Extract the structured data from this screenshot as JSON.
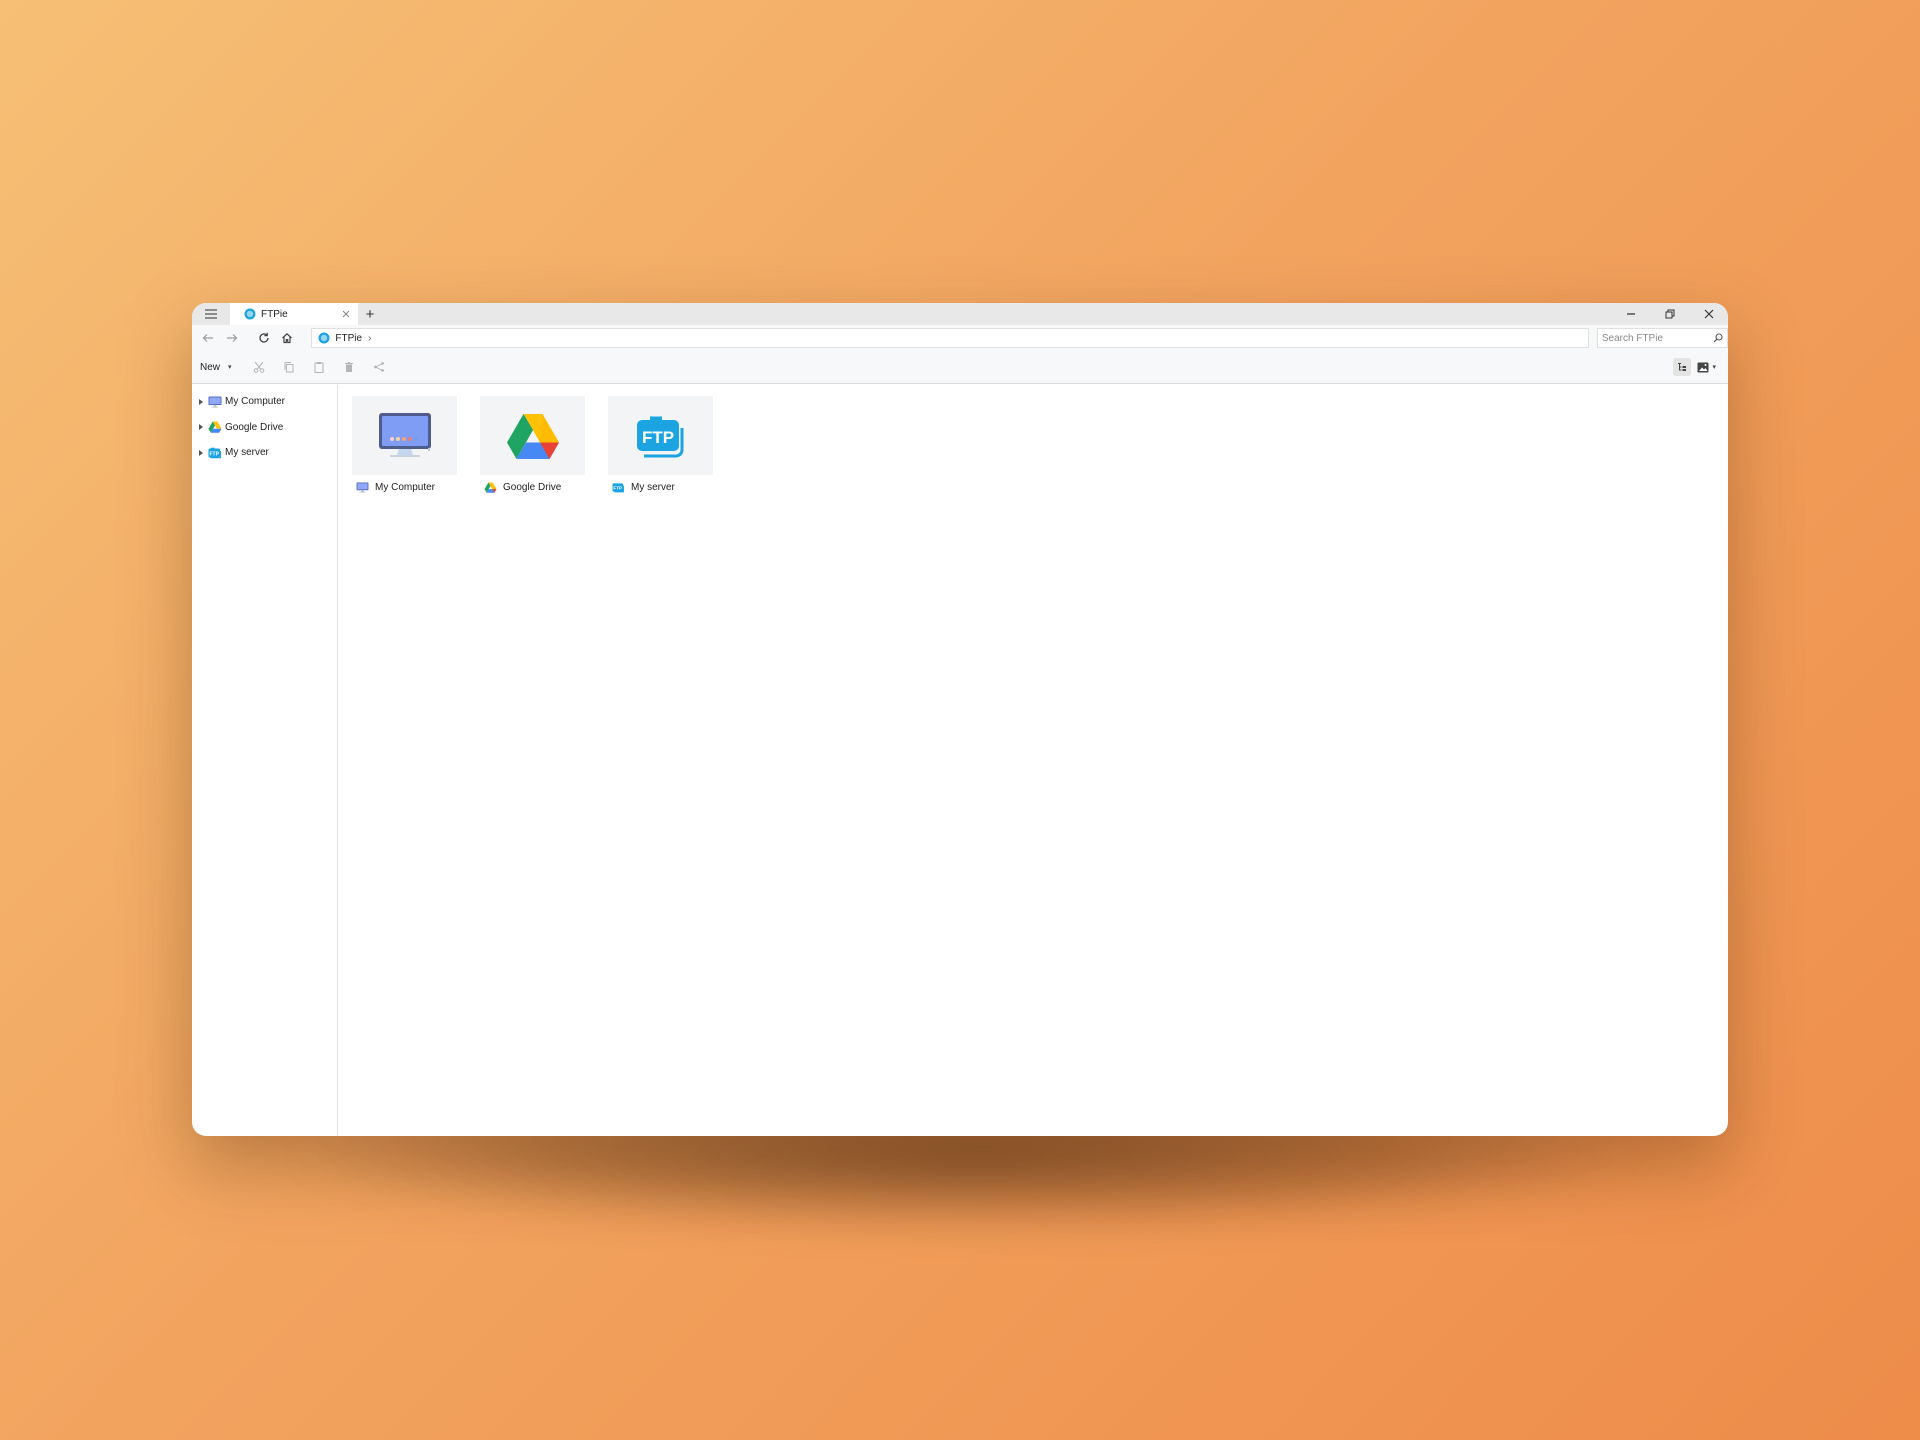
{
  "app": {
    "tab_title": "FTPie",
    "new_tab_symbol": "+"
  },
  "nav": {
    "breadcrumb": "FTPie",
    "breadcrumb_separator": "›",
    "search_placeholder": "Search FTPie"
  },
  "toolbar": {
    "new_label": "New",
    "new_caret": "▾",
    "image_caret": "▾"
  },
  "sidebar": {
    "items": [
      {
        "label": "My Computer",
        "icon": "computer-icon"
      },
      {
        "label": "Google Drive",
        "icon": "google-drive-icon"
      },
      {
        "label": "My server",
        "icon": "ftp-server-icon"
      }
    ]
  },
  "content": {
    "items": [
      {
        "label": "My Computer",
        "icon": "computer-icon"
      },
      {
        "label": "Google Drive",
        "icon": "google-drive-icon"
      },
      {
        "label": "My server",
        "icon": "ftp-server-icon"
      }
    ]
  },
  "colors": {
    "accent": "#1ba3e2",
    "drive_green": "#1fa463",
    "drive_yellow": "#ffd04b",
    "drive_blue": "#4688f4",
    "computer_screen": "#7f9cf5"
  }
}
